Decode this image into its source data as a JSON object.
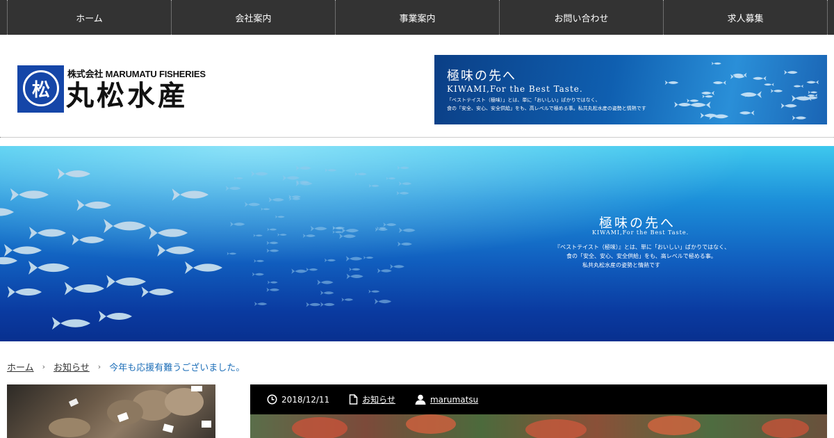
{
  "nav": {
    "items": [
      {
        "label": "ホーム"
      },
      {
        "label": "会社案内"
      },
      {
        "label": "事業案内"
      },
      {
        "label": "お問い合わせ"
      },
      {
        "label": "求人募集"
      }
    ]
  },
  "logo": {
    "kanji": "松",
    "subtitle": "株式会社 MARUMATU FISHERIES",
    "name": "丸松水産"
  },
  "header_banner": {
    "title": "極味の先へ",
    "subtitle_en": "KIWAMI,For the Best Taste.",
    "desc_line1": "「ベストテイスト（極味）」とは、単に「おいしい」ばかりではなく、",
    "desc_line2": "食の「安全、安心、安全供給」をも、高レベルで極める事。私共丸松水産の姿勢と情熱です"
  },
  "hero": {
    "title": "極味の先へ",
    "subtitle_en": "KIWAMI,For the Best Taste.",
    "desc_line1": "『ベストテイスト（極味）』とは、単に「おいしい」ばかりではなく、",
    "desc_line2": "食の「安全、安心、安全供給」をも、高レベルで極める事。",
    "desc_line3": "私共丸松水産の姿勢と情熱です"
  },
  "breadcrumb": {
    "home": "ホーム",
    "category": "お知らせ",
    "current": "今年も応援有難うございました。",
    "separator": "›"
  },
  "post": {
    "date": "2018/12/11",
    "category": "お知らせ",
    "author": "marumatsu"
  },
  "colors": {
    "nav_bg": "#333333",
    "brand_blue": "#1546a8",
    "breadcrumb_current": "#1e6fb8",
    "meta_bar": "#000000"
  }
}
